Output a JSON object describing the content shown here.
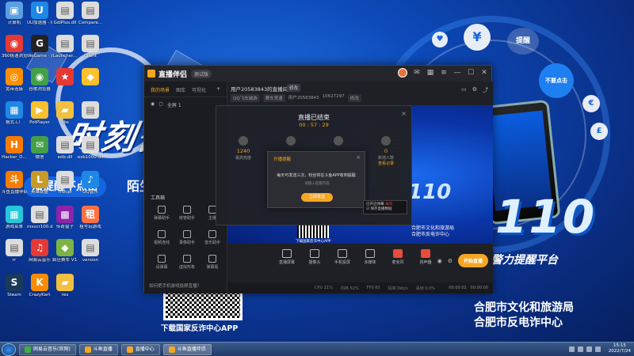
{
  "wallpaper": {
    "slogan": "时刻警",
    "banner1": "知提醒不点击",
    "banner2": "陌生",
    "banner3": "陌生",
    "bubble1": "¥",
    "bubble2": "提醒",
    "bubble3": "不要点击",
    "big110": "110",
    "sub110": "警力提醒平台",
    "org1": "合肥市文化和旅游局",
    "org2": "合肥市反电诈中心",
    "qr_caption": "下载国家反诈中心APP"
  },
  "desktop_icons": [
    {
      "label": "计算机",
      "color": "#5aa0e0",
      "glyph": "▣"
    },
    {
      "label": "UU加速器 - 网游加速",
      "color": "#1e88e5",
      "glyph": "U"
    },
    {
      "label": "GdiPlus.dll",
      "color": "#dddddd",
      "glyph": "▤"
    },
    {
      "label": "Compare...",
      "color": "#dddddd",
      "glyph": "▤"
    },
    {
      "label": "360极速浏览器",
      "color": "#e53935",
      "glyph": "◉"
    },
    {
      "label": "WeGame - 腾讯游戏",
      "color": "#222222",
      "glyph": "G"
    },
    {
      "label": "Launcher...",
      "color": "#dddddd",
      "glyph": "▤"
    },
    {
      "label": "Client",
      "color": "#dddddd",
      "glyph": "▤"
    },
    {
      "label": "宽带连接",
      "color": "#ff8f00",
      "glyph": "◎"
    },
    {
      "label": "谷歌浏览器",
      "color": "#43a047",
      "glyph": "◉"
    },
    {
      "label": "",
      "color": "#e53935",
      "glyph": "★"
    },
    {
      "label": "",
      "color": "#fbc02d",
      "glyph": "◆"
    },
    {
      "label": "格式工厂",
      "color": "#1e88e5",
      "glyph": "▦"
    },
    {
      "label": "PotPlayer",
      "color": "#fbc02d",
      "glyph": "▶"
    },
    {
      "label": "libs",
      "color": "#f0c040",
      "glyph": "▰"
    },
    {
      "label": "",
      "color": "#dddddd",
      "glyph": "▤"
    },
    {
      "label": "Hacker_D...",
      "color": "#f57c00",
      "glyph": "H"
    },
    {
      "label": "微信",
      "color": "#43a047",
      "glyph": "✉"
    },
    {
      "label": "edb.dll",
      "color": "#dddddd",
      "glyph": "▤"
    },
    {
      "label": "esb1000.dll",
      "color": "#dddddd",
      "glyph": "▤"
    },
    {
      "label": "斗鱼直播伴侣",
      "color": "#f57c00",
      "glyph": "斗"
    },
    {
      "label": "英雄联盟",
      "color": "#c79a2a",
      "glyph": "L"
    },
    {
      "label": "mvcpi",
      "color": "#dddddd",
      "glyph": "▤"
    },
    {
      "label": "QQ音乐",
      "color": "#1e88e5",
      "glyph": "♪"
    },
    {
      "label": "游戏菜单",
      "color": "#26c6da",
      "glyph": "▦"
    },
    {
      "label": "msvcr100.dll",
      "color": "#dddddd",
      "glyph": "▤"
    },
    {
      "label": "传奇盒子",
      "color": "#8e24aa",
      "glyph": "▩"
    },
    {
      "label": "租号玩游戏",
      "color": "#ff7043",
      "glyph": "租"
    },
    {
      "label": "rr",
      "color": "#dddddd",
      "glyph": "▤"
    },
    {
      "label": "网易云音乐",
      "color": "#e53935",
      "glyph": "♫"
    },
    {
      "label": "疯狂赛车 V1.3988002",
      "color": "#7cb342",
      "glyph": "◆"
    },
    {
      "label": "version",
      "color": "#dddddd",
      "glyph": "▤"
    },
    {
      "label": "Steam",
      "color": "#1a3a5a",
      "glyph": "S"
    },
    {
      "label": "CrazyKart",
      "color": "#fb8c00",
      "glyph": "K"
    },
    {
      "label": "res",
      "color": "#f0c040",
      "glyph": "▰"
    }
  ],
  "app": {
    "name": "直播伴侣",
    "version": "测试版",
    "left_tabs": [
      "我的场景",
      "图库",
      "可视化"
    ],
    "scene_label": "全屏 1",
    "tools_title": "工具箱",
    "tools": [
      "弹幕助手",
      "房管助手",
      "主播",
      "视频连线",
      "录像助手",
      "音乐助手",
      "设弹幕",
      "虚拟形象",
      "弹幕看"
    ],
    "bottom_hint": "如何把手机游戏投屏直播？",
    "room_title": "用户20583843的直播间",
    "room_tag": "修改",
    "category": "QQ飞车端游",
    "category2": "赛车竞速",
    "user_id": "用户20583843",
    "room_num": "10627297",
    "room_edit": "修改",
    "toolbar": [
      {
        "label": "直播屏幕",
        "red": false
      },
      {
        "label": "摄像头",
        "red": false
      },
      {
        "label": "手机投屏",
        "red": false
      },
      {
        "label": "多媒体",
        "red": false
      },
      {
        "label": "麦克风",
        "red": true
      },
      {
        "label": "扬声器",
        "red": true
      }
    ],
    "start_button": "开始直播",
    "status": {
      "cpu": "CPU 21%",
      "mem": "内存 52%",
      "fps": "FPS 60",
      "bitrate": "码率 0kb/s",
      "drop": "丢帧 0.0%",
      "timer": "00:00:02",
      "timer2": "00:00:00"
    },
    "preview": {
      "big110": "110",
      "org": "合肥市文化和旅游局\n合肥市反电诈中心",
      "qr_caption": "下载国家反诈中心APP"
    }
  },
  "ended_dialog": {
    "title": "直播已结束",
    "time": "00 : 57 : 29",
    "close": "×",
    "stats": [
      {
        "value": "1240",
        "label": "最高热度",
        "link": ""
      },
      {
        "value": "",
        "label": "",
        "link": ""
      },
      {
        "value": "",
        "label": "",
        "link": ""
      },
      {
        "value": "0",
        "label": "新增人数",
        "link": "查看记录"
      }
    ]
  },
  "reminder": {
    "title": "开播提醒",
    "close": "×",
    "text": "每天可发送三次，粉丝将在斗鱼APP收到提醒",
    "input_placeholder": "请输入提醒内容",
    "button": "立即发送"
  },
  "side_chip": {
    "line1": "已开启弹幕",
    "line1_red": "关闭",
    "line2": "保存直播数据"
  },
  "taskbar": {
    "tasks": [
      "网易云音乐(官网)",
      "斗鱼直播",
      "直播中心",
      "斗鱼直播伴侣"
    ],
    "time": "15:15",
    "date": "2022/7/24"
  }
}
